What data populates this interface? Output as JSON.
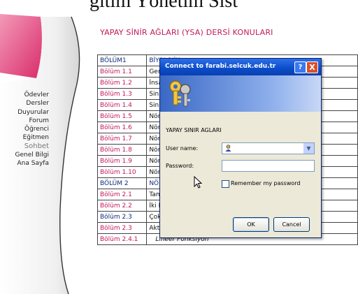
{
  "top_heading": "ğıtım Yönetim Sist",
  "nav": {
    "items": [
      {
        "label": "Ödevler",
        "bold": false
      },
      {
        "label": "Dersler",
        "bold": false
      },
      {
        "label": "Duyurular",
        "bold": false
      },
      {
        "label": "Forum",
        "bold": false
      },
      {
        "label": "Öğrenci",
        "bold": false
      },
      {
        "label": "Eğitmen",
        "bold": false
      },
      {
        "label": "Sohbet",
        "bold": true
      },
      {
        "label": "Genel Bilgi",
        "bold": false
      },
      {
        "label": "Ana Sayfa",
        "bold": false
      }
    ]
  },
  "page_title": "YAPAY SİNİR AĞLARI (YSA) DERSİ KONULARI",
  "topics": [
    {
      "code": "BÖLÜM1",
      "title": "BİYOLOJİK",
      "code_plain": true,
      "title_section": true,
      "italic": false
    },
    {
      "code": "Bölüm 1.1",
      "title": "Genel",
      "code_plain": false,
      "title_section": false,
      "italic": false
    },
    {
      "code": "Bölüm 1.2",
      "title": "İnsan",
      "code_plain": false,
      "title_section": false,
      "italic": false
    },
    {
      "code": "Bölüm 1.3",
      "title": "Sinir",
      "code_plain": false,
      "title_section": false,
      "italic": false
    },
    {
      "code": "Bölüm 1.4",
      "title": "Sinir",
      "code_plain": false,
      "title_section": false,
      "italic": false
    },
    {
      "code": "Bölüm 1.5",
      "title": "Nöron",
      "code_plain": false,
      "title_section": false,
      "italic": false
    },
    {
      "code": "Bölüm 1.6",
      "title": "Nöron",
      "code_plain": false,
      "title_section": false,
      "italic": false
    },
    {
      "code": "Bölüm 1.7",
      "title": "Nöron",
      "code_plain": false,
      "title_section": false,
      "italic": false
    },
    {
      "code": "Bölüm 1.8",
      "title": "Nöron",
      "code_plain": false,
      "title_section": false,
      "italic": false
    },
    {
      "code": "Bölüm 1.9",
      "title": "Nöron",
      "code_plain": false,
      "title_section": false,
      "italic": false
    },
    {
      "code": "Bölüm 1.10",
      "title": "Nöron",
      "code_plain": false,
      "title_section": false,
      "italic": false
    },
    {
      "code": "BÖLÜM 2",
      "title": "NÖRON",
      "code_plain": true,
      "title_section": true,
      "italic": false
    },
    {
      "code": "Bölüm 2.1",
      "title": "Tam",
      "code_plain": false,
      "title_section": false,
      "italic": false
    },
    {
      "code": "Bölüm 2.2",
      "title": "İki Katlı Nöron Ağları",
      "code_plain": false,
      "title_section": false,
      "italic": false
    },
    {
      "code": "Bölüm 2.3",
      "title": "Çok Katlı Nöron Ağları",
      "code_plain": true,
      "title_section": false,
      "italic": false
    },
    {
      "code": "Bölüm 2.3",
      "title": "Aktifleşme Fonksiyonu",
      "code_plain": false,
      "title_section": false,
      "italic": false
    },
    {
      "code": "Bölüm 2.4.1",
      "title": "Lineer Fonksiyon",
      "code_plain": false,
      "title_section": false,
      "italic": true
    }
  ],
  "dialog": {
    "title": "Connect to farabi.selcuk.edu.tr",
    "help_glyph": "?",
    "close_glyph": "X",
    "realm": "YAPAY SINIR AGLARI",
    "username_label": "User name:",
    "username_value": "",
    "password_label": "Password:",
    "remember_label": "Remember my password",
    "remember_checked": false,
    "ok_label": "OK",
    "cancel_label": "Cancel"
  },
  "colors": {
    "accent_pink": "#c2185b",
    "link_blue": "#0b2b7a",
    "xp_title_blue": "#0b4cc9",
    "dialog_bg": "#ece9d8"
  },
  "icons": [
    "keys-icon",
    "user-account-icon",
    "dropdown-arrow-icon",
    "help-icon",
    "close-icon",
    "mouse-cursor-icon"
  ]
}
